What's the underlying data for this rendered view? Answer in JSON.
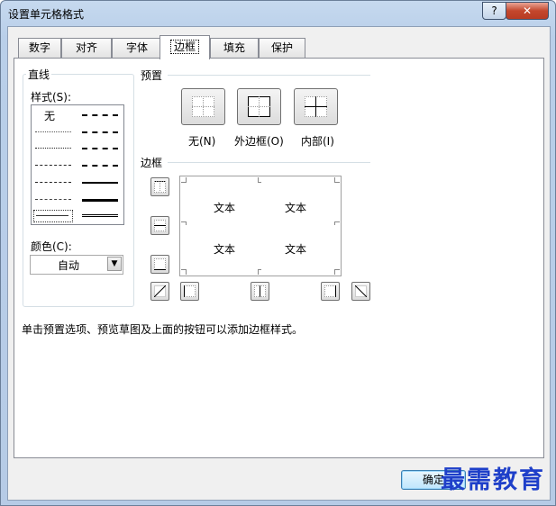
{
  "window": {
    "title": "设置单元格格式",
    "help_label": "?",
    "close_label": "✕"
  },
  "tabs": [
    {
      "label": "数字"
    },
    {
      "label": "对齐"
    },
    {
      "label": "字体"
    },
    {
      "label": "边框"
    },
    {
      "label": "填充"
    },
    {
      "label": "保护"
    }
  ],
  "active_tab": "边框",
  "line_group": {
    "title": "直线",
    "style_label": "样式(S):",
    "none_label": "无",
    "color_label": "颜色(C):",
    "color_value": "自动"
  },
  "presets": {
    "title": "预置",
    "none_label": "无(N)",
    "outline_label": "外边框(O)",
    "inside_label": "内部(I)"
  },
  "border": {
    "title": "边框",
    "preview_text": [
      "文本",
      "文本",
      "文本",
      "文本"
    ]
  },
  "hint": "单击预置选项、预览草图及上面的按钮可以添加边框样式。",
  "buttons": {
    "ok_label": "确定"
  },
  "watermark": "最需教育",
  "colors": {
    "accent": "#1e3fc9",
    "title_bar": "#b9cfe9"
  }
}
